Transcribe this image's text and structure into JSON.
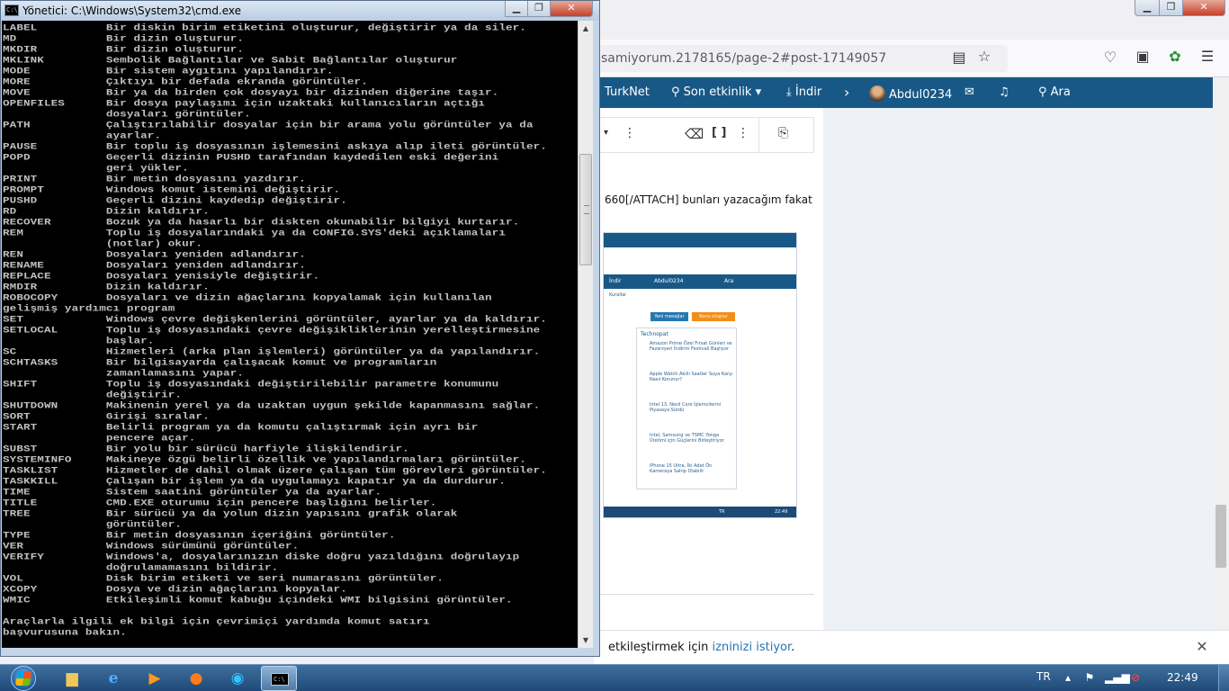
{
  "browser": {
    "url": "samiyorum.2178165/page-2#post-17149057",
    "nav": {
      "turknet": "TurkNet",
      "activity": "Son etkinlik",
      "download": "İndir",
      "user": "Abdul0234",
      "search": "Ara"
    },
    "post_text": "660[/ATTACH] bunları yazacağım fakat",
    "embedded": {
      "nav_download": "İndir",
      "nav_user": "Abdul0234",
      "nav_search": "Ara",
      "rules": "Kurallar",
      "btn_new": "Yeni mesajlar",
      "btn_create": "Konu oluştur",
      "panel_title": "Technopat",
      "items": [
        "Amazon Prime Özel Fırsat Günleri ve Fazarzyeri İndirim Festivali Başlıyor",
        "Apple Watch Akıllı Saatler Suya Karşı Nasıl Korunur?",
        "Intel 13. Nesil Core İşlemcilerini Piyasaya Sürdü",
        "Intel, Samsung ve TSMC Yonga Üretimi için Güçlerini Birleştiriyor",
        "iPhone 15 Ultra, İki Adet Ön Kameraya Sahip Olabilir"
      ],
      "tray_lang": "TR",
      "clock": "22:49"
    },
    "consent_text": "etkileştirmek için ",
    "consent_link": "izninizi istiyor",
    "consent_suffix": "."
  },
  "cmd": {
    "title": "Yönetici: C:\\Windows\\System32\\cmd.exe",
    "lines": [
      "LABEL          Bir diskin birim etiketini oluşturur, değiştirir ya da siler.",
      "MD             Bir dizin oluşturur.",
      "MKDIR          Bir dizin oluşturur.",
      "MKLINK         Sembolik Bağlantılar ve Sabit Bağlantılar oluşturur",
      "MODE           Bir sistem aygıtını yapılandırır.",
      "MORE           Çıktıyı bir defada ekranda görüntüler.",
      "MOVE           Bir ya da birden çok dosyayı bir dizinden diğerine taşır.",
      "OPENFILES      Bir dosya paylaşımı için uzaktaki kullanıcıların açtığı",
      "               dosyaları görüntüler.",
      "PATH           Çalıştırılabilir dosyalar için bir arama yolu görüntüler ya da",
      "               ayarlar.",
      "PAUSE          Bir toplu iş dosyasının işlemesini askıya alıp ileti görüntüler.",
      "POPD           Geçerli dizinin PUSHD tarafından kaydedilen eski değerini",
      "               geri yükler.",
      "PRINT          Bir metin dosyasını yazdırır.",
      "PROMPT         Windows komut istemini değiştirir.",
      "PUSHD          Geçerli dizini kaydedip değiştirir.",
      "RD             Dizin kaldırır.",
      "RECOVER        Bozuk ya da hasarlı bir diskten okunabilir bilgiyi kurtarır.",
      "REM            Toplu iş dosyalarındaki ya da CONFIG.SYS'deki açıklamaları",
      "               (notlar) okur.",
      "REN            Dosyaları yeniden adlandırır.",
      "RENAME         Dosyaları yeniden adlandırır.",
      "REPLACE        Dosyaları yenisiyle değiştirir.",
      "RMDIR          Dizin kaldırır.",
      "ROBOCOPY       Dosyaları ve dizin ağaçlarını kopyalamak için kullanılan",
      "gelişmiş yardımcı program",
      "SET            Windows çevre değişkenlerini görüntüler, ayarlar ya da kaldırır.",
      "SETLOCAL       Toplu iş dosyasındaki çevre değişikliklerinin yerelleştirmesine",
      "               başlar.",
      "SC             Hizmetleri (arka plan işlemleri) görüntüler ya da yapılandırır.",
      "SCHTASKS       Bir bilgisayarda çalışacak komut ve programların",
      "               zamanlamasını yapar.",
      "SHIFT          Toplu iş dosyasındaki değiştirilebilir parametre konumunu",
      "               değiştirir.",
      "SHUTDOWN       Makinenin yerel ya da uzaktan uygun şekilde kapanmasını sağlar.",
      "SORT           Girişi sıralar.",
      "START          Belirli program ya da komutu çalıştırmak için ayrı bir",
      "               pencere açar.",
      "SUBST          Bir yolu bir sürücü harfiyle ilişkilendirir.",
      "SYSTEMINFO     Makineye özgü belirli özellik ve yapılandırmaları görüntüler.",
      "TASKLIST       Hizmetler de dahil olmak üzere çalışan tüm görevleri görüntüler.",
      "TASKKILL       Çalışan bir işlem ya da uygulamayı kapatır ya da durdurur.",
      "TIME           Sistem saatini görüntüler ya da ayarlar.",
      "TITLE          CMD.EXE oturumu için pencere başlığını belirler.",
      "TREE           Bir sürücü ya da yolun dizin yapısını grafik olarak",
      "               görüntüler.",
      "TYPE           Bir metin dosyasının içeriğini görüntüler.",
      "VER            Windows sürümünü görüntüler.",
      "VERIFY         Windows'a, dosyalarınızın diske doğru yazıldığını doğrulayıp",
      "               doğrulamamasını bildirir.",
      "VOL            Disk birim etiketi ve seri numarasını görüntüler.",
      "XCOPY          Dosya ve dizin ağaçlarını kopyalar.",
      "WMIC           Etkileşimli komut kabuğu içindeki WMI bilgisini görüntüler.",
      "",
      "Araçlarla ilgili ek bilgi için çevrimiçi yardımda komut satırı",
      "başvurusuna bakın."
    ]
  },
  "taskbar": {
    "lang": "TR",
    "clock": "22:49"
  }
}
